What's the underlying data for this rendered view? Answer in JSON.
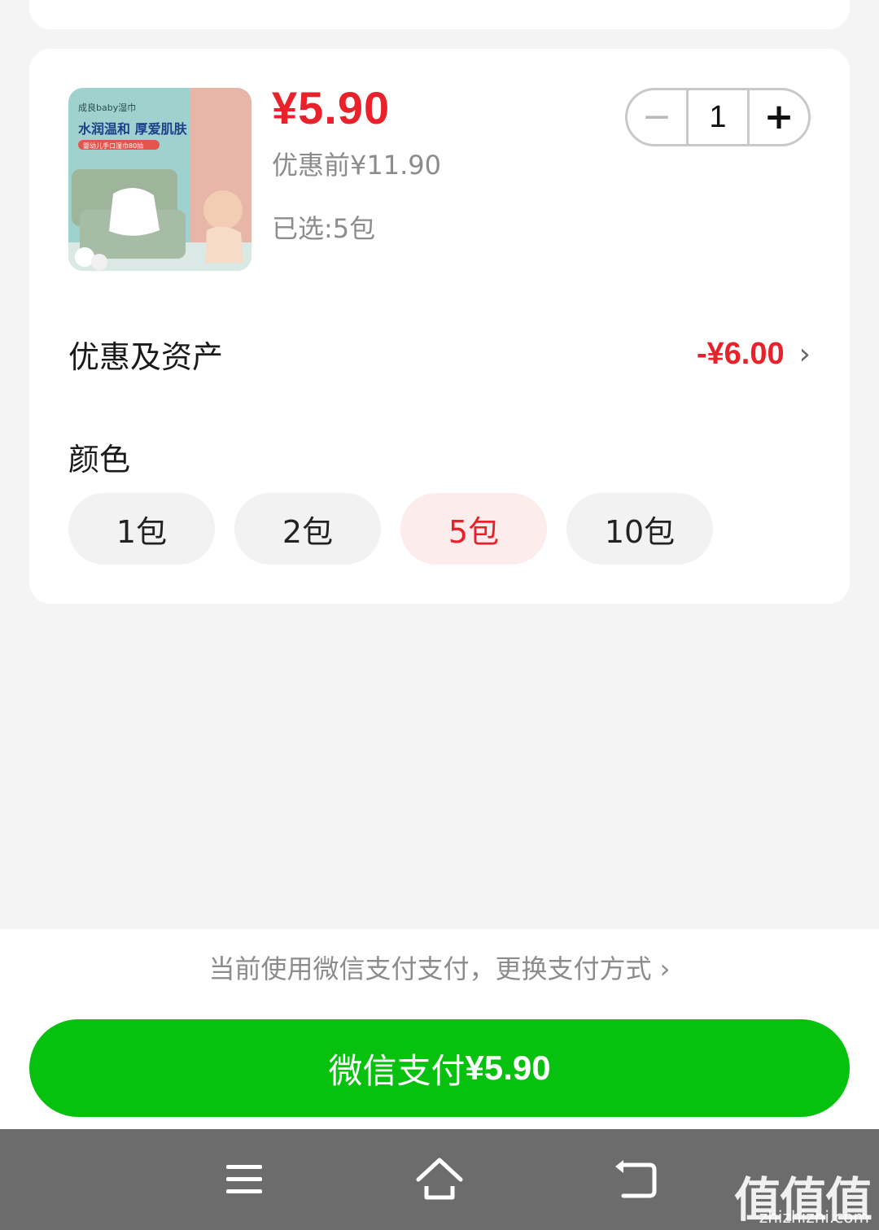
{
  "product": {
    "price": "¥5.90",
    "original_price": "优惠前¥11.90",
    "selected": "已选:5包",
    "image_text": {
      "brand": "成良baby湿巾",
      "headline": "水润温和 厚爱肌肤",
      "tag": "婴幼儿手口湿巾80抽"
    }
  },
  "stepper": {
    "minus": "−",
    "value": "1",
    "plus": "+"
  },
  "discount": {
    "label": "优惠及资产",
    "value": "-¥6.00"
  },
  "color": {
    "label": "颜色",
    "options": [
      "1包",
      "2包",
      "5包",
      "10包"
    ],
    "selected_index": 2
  },
  "payment": {
    "switch_text": "当前使用微信支付支付，更换支付方式 ›",
    "button_label": "微信支付",
    "button_amount": "¥5.90",
    "accent": "#07c10f"
  },
  "colors": {
    "price_red": "#e8212b",
    "navbar": "#6c6c6c"
  },
  "watermark": {
    "main": "值值值",
    "sub": "zhizhizhi.com"
  }
}
